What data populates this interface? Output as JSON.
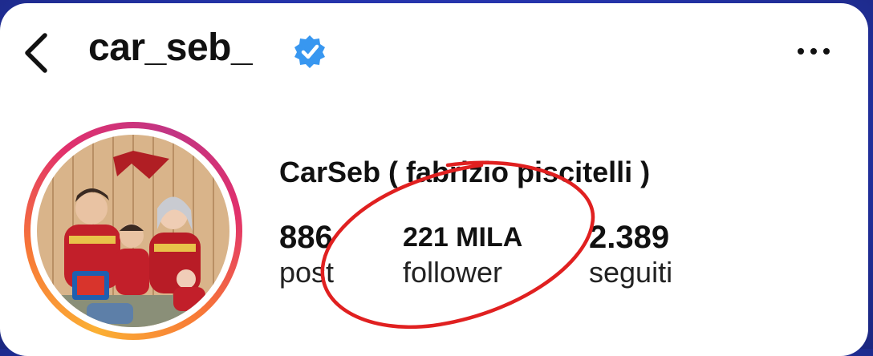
{
  "profile": {
    "username": "car_seb_",
    "full_name": "CarSeb ( fabrizio piscitelli )",
    "verified_icon": "verified-badge-icon",
    "back_icon": "chevron-left-icon",
    "more_icon": "more-options-icon"
  },
  "stats": [
    {
      "value": "886",
      "label": "post"
    },
    {
      "value": "221 MILA",
      "label": "follower"
    },
    {
      "value": "2.389",
      "label": "seguiti"
    }
  ],
  "colors": {
    "background": "#2433a8",
    "verified": "#3897f0",
    "annotation": "#e02020"
  }
}
